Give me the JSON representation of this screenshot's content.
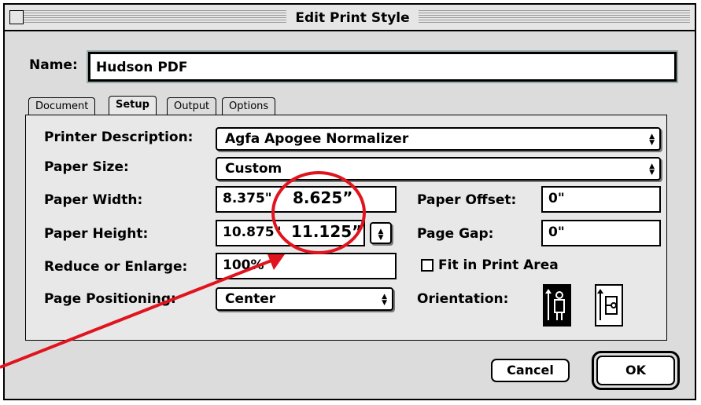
{
  "window": {
    "title": "Edit Print Style"
  },
  "name_field": {
    "label": "Name:",
    "value": "Hudson PDF"
  },
  "tabs": [
    {
      "label": "Document",
      "active": false
    },
    {
      "label": "Setup",
      "active": true
    },
    {
      "label": "Output",
      "active": false
    },
    {
      "label": "Options",
      "active": false
    }
  ],
  "setup": {
    "printer_description": {
      "label": "Printer Description:",
      "value": "Agfa Apogee Normalizer"
    },
    "paper_size": {
      "label": "Paper Size:",
      "value": "Custom"
    },
    "paper_width": {
      "label": "Paper Width:",
      "value": "8.375\""
    },
    "paper_height": {
      "label": "Paper Height:",
      "value": "10.875\""
    },
    "reduce_enlarge": {
      "label": "Reduce or Enlarge:",
      "value": "100%"
    },
    "page_positioning": {
      "label": "Page Positioning:",
      "value": "Center"
    },
    "paper_offset": {
      "label": "Paper Offset:",
      "value": "0\""
    },
    "page_gap": {
      "label": "Page Gap:",
      "value": "0\""
    },
    "fit_in_print_area": {
      "label": "Fit in Print Area",
      "checked": false
    },
    "orientation": {
      "label": "Orientation:",
      "selected": "portrait"
    }
  },
  "annotation": {
    "width_note": "8.625”",
    "height_note": "11.125”",
    "color": "#e0141e"
  },
  "buttons": {
    "cancel": "Cancel",
    "ok": "OK"
  }
}
